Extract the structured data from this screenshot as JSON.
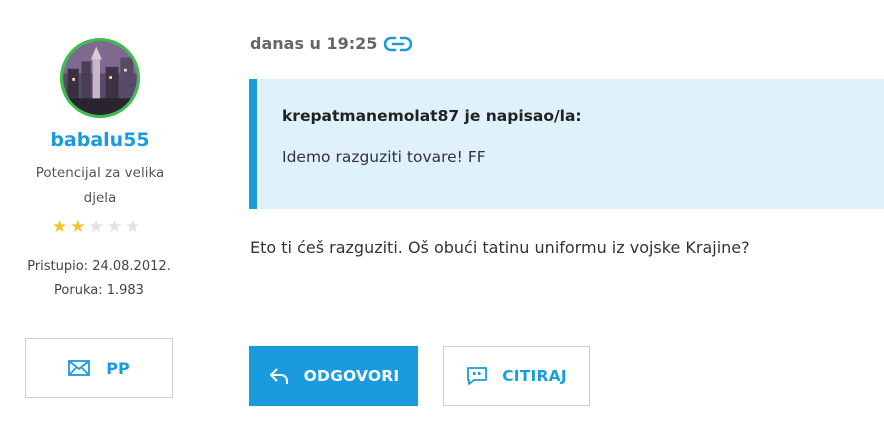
{
  "user": {
    "username": "babalu55",
    "rank": "Potencijal za velika djela",
    "rating": {
      "filled": 2,
      "total": 5
    },
    "joined": "Pristupio: 24.08.2012.",
    "posts": "Poruka: 1.983",
    "pm_label": "PP"
  },
  "post": {
    "time": "danas u 19:25",
    "quote": {
      "author": "krepatmanemolat87 je napisao/la:",
      "text": "Idemo razguziti tovare! FF"
    },
    "message": "Eto ti ćeš razguziti. Oš obući tatinu uniformu iz vojske Krajine?"
  },
  "actions": {
    "reply": "ODGOVORI",
    "quote": "CITIRAJ"
  },
  "colors": {
    "accent": "#1a9be0",
    "quote_bg": "#dff1fb",
    "star_on": "#f2c12e",
    "star_off": "#e2e2e2",
    "avatar_ring": "#3cbf4a"
  },
  "icons": [
    "avatar-image",
    "star-icon",
    "mail-icon",
    "link-icon",
    "reply-icon",
    "quote-icon"
  ]
}
